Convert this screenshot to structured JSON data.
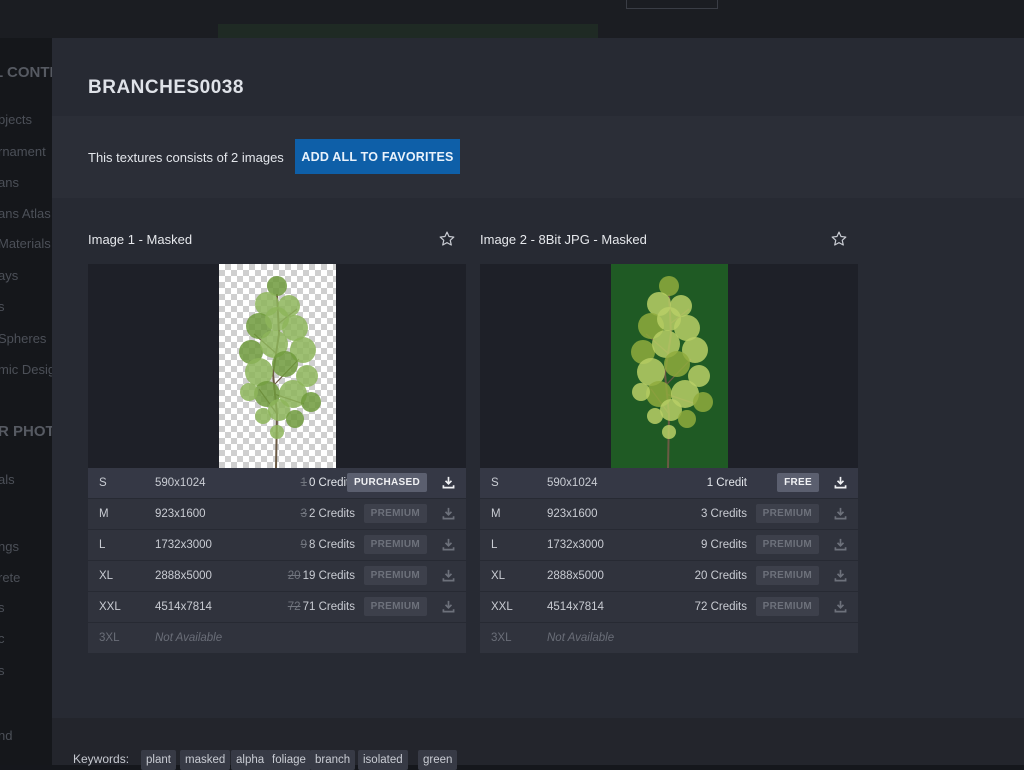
{
  "background_sidebar": {
    "items": [
      "L CONTE",
      "bjects",
      "rnament",
      "ans",
      "ans Atlas",
      "Materials",
      "ays",
      "s",
      "Spheres",
      "mic Desig",
      "R PHOTO",
      "als",
      "ngs",
      "rete",
      "s",
      "c",
      "s",
      "nd"
    ]
  },
  "modal": {
    "title": "BRANCHES0038",
    "info_text": "This textures consists of 2 images",
    "add_all_label": "ADD ALL TO FAVORITES",
    "images": [
      {
        "title": "Image 1 - Masked",
        "preview": "checker",
        "rows": [
          {
            "size": "S",
            "res": "590x1024",
            "old": "1",
            "credits": "0 Credits",
            "badge": "PURCHASED"
          },
          {
            "size": "M",
            "res": "923x1600",
            "old": "3",
            "credits": "2 Credits",
            "badge": "PREMIUM"
          },
          {
            "size": "L",
            "res": "1732x3000",
            "old": "9",
            "credits": "8 Credits",
            "badge": "PREMIUM"
          },
          {
            "size": "XL",
            "res": "2888x5000",
            "old": "20",
            "credits": "19 Credits",
            "badge": "PREMIUM"
          },
          {
            "size": "XXL",
            "res": "4514x7814",
            "old": "72",
            "credits": "71 Credits",
            "badge": "PREMIUM"
          },
          {
            "size": "3XL",
            "res": "Not Available"
          }
        ]
      },
      {
        "title": "Image 2 - 8Bit JPG - Masked",
        "preview": "green",
        "rows": [
          {
            "size": "S",
            "res": "590x1024",
            "old": "",
            "credits": "1 Credit",
            "badge": "FREE"
          },
          {
            "size": "M",
            "res": "923x1600",
            "old": "",
            "credits": "3 Credits",
            "badge": "PREMIUM"
          },
          {
            "size": "L",
            "res": "1732x3000",
            "old": "",
            "credits": "9 Credits",
            "badge": "PREMIUM"
          },
          {
            "size": "XL",
            "res": "2888x5000",
            "old": "",
            "credits": "20 Credits",
            "badge": "PREMIUM"
          },
          {
            "size": "XXL",
            "res": "4514x7814",
            "old": "",
            "credits": "72 Credits",
            "badge": "PREMIUM"
          },
          {
            "size": "3XL",
            "res": "Not Available"
          }
        ]
      }
    ],
    "keywords_label": "Keywords:",
    "keywords": [
      "plant",
      "masked",
      "alpha",
      "foliage",
      "branch",
      "isolated",
      "green"
    ]
  },
  "icons": {
    "favorite": "star-outline-icon",
    "download": "download-icon"
  },
  "colors": {
    "accent": "#0e5fa8",
    "background": "#272a33"
  }
}
